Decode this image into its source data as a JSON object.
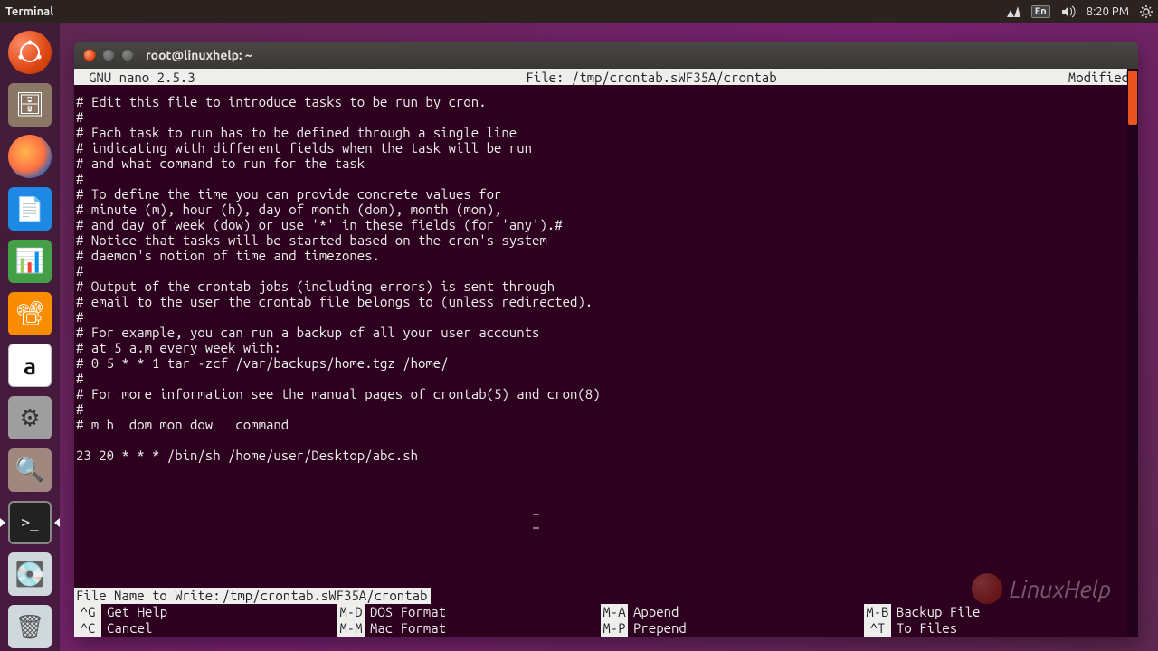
{
  "top_panel": {
    "title": "Terminal",
    "lang": "En",
    "time": "8:20 PM"
  },
  "launcher": [
    {
      "name": "dash",
      "glyph": "◌"
    },
    {
      "name": "files",
      "glyph": "🗄"
    },
    {
      "name": "firefox",
      "glyph": "🦊"
    },
    {
      "name": "writer",
      "glyph": "📄"
    },
    {
      "name": "calc",
      "glyph": "📊"
    },
    {
      "name": "impress",
      "glyph": "📈"
    },
    {
      "name": "amazon",
      "glyph": "a"
    },
    {
      "name": "settings",
      "glyph": "⚙"
    },
    {
      "name": "search",
      "glyph": "🔍"
    },
    {
      "name": "terminal",
      "glyph": ">_"
    },
    {
      "name": "disk",
      "glyph": "💽"
    },
    {
      "name": "trash",
      "glyph": "🗑"
    }
  ],
  "window": {
    "title": "root@linuxhelp: ~"
  },
  "nano": {
    "app": "GNU nano 2.5.3",
    "file_label": "File: /tmp/crontab.sWF35A/crontab",
    "status": "Modified",
    "lines": [
      "# Edit this file to introduce tasks to be run by cron.",
      "#",
      "# Each task to run has to be defined through a single line",
      "# indicating with different fields when the task will be run",
      "# and what command to run for the task",
      "#",
      "# To define the time you can provide concrete values for",
      "# minute (m), hour (h), day of month (dom), month (mon),",
      "# and day of week (dow) or use '*' in these fields (for 'any').#",
      "# Notice that tasks will be started based on the cron's system",
      "# daemon's notion of time and timezones.",
      "#",
      "# Output of the crontab jobs (including errors) is sent through",
      "# email to the user the crontab file belongs to (unless redirected).",
      "#",
      "# For example, you can run a backup of all your user accounts",
      "# at 5 a.m every week with:",
      "# 0 5 * * 1 tar -zcf /var/backups/home.tgz /home/",
      "#",
      "# For more information see the manual pages of crontab(5) and cron(8)",
      "#",
      "# m h  dom mon dow   command",
      "",
      "23 20 * * * /bin/sh /home/user/Desktop/abc.sh"
    ],
    "prompt_label": "File Name to Write: ",
    "prompt_value": "/tmp/crontab.sWF35A/crontab",
    "shortcuts": [
      {
        "key": "^G",
        "desc": "Get Help"
      },
      {
        "key": "M-D",
        "desc": "DOS Format"
      },
      {
        "key": "M-A",
        "desc": "Append"
      },
      {
        "key": "M-B",
        "desc": "Backup File"
      },
      {
        "key": "^C",
        "desc": "Cancel"
      },
      {
        "key": "M-M",
        "desc": "Mac Format"
      },
      {
        "key": "M-P",
        "desc": "Prepend"
      },
      {
        "key": "^T",
        "desc": "To Files"
      }
    ]
  },
  "watermark": "LinuxHelp"
}
